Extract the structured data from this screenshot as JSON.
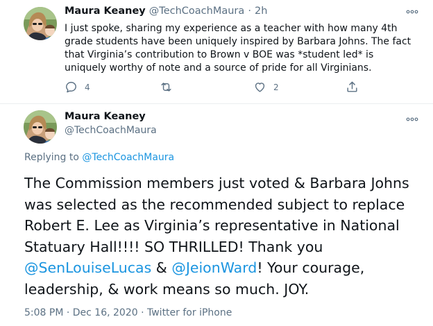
{
  "tweet1": {
    "name": "Maura Keaney",
    "handle": "@TechCoachMaura",
    "separator": "·",
    "time": "2h",
    "more": "ooo",
    "text": "I just spoke, sharing my experience as a teacher with how many 4th grade students have been uniquely inspired by Barbara Johns.  The fact that Virginia’s contribution to Brown v BOE was *student led* is uniquely worthy of note and a source of pride for all Virginians.",
    "replies": "4",
    "retweets": "",
    "likes": "2"
  },
  "tweet2": {
    "name": "Maura Keaney",
    "handle": "@TechCoachMaura",
    "more": "ooo",
    "replying_prefix": "Replying to ",
    "replying_to": "@TechCoachMaura",
    "text_a": "The Commission members just voted & Barbara Johns was selected as the recommended subject to replace Robert E. Lee as Virginia’s representative in National Statuary Hall!!!! SO THRILLED! Thank you ",
    "mention1": "@SenLouiseLucas",
    "text_b": " & ",
    "mention2": "@JeionWard",
    "text_c": "!  Your courage, leadership, & work means so much. JOY.",
    "meta": "5:08 PM · Dec 16, 2020 · Twitter for iPhone"
  },
  "colors": {
    "text": "#0f1419",
    "secondary": "#5b7083",
    "link": "#1b95e0",
    "divider": "#ebeef0"
  }
}
